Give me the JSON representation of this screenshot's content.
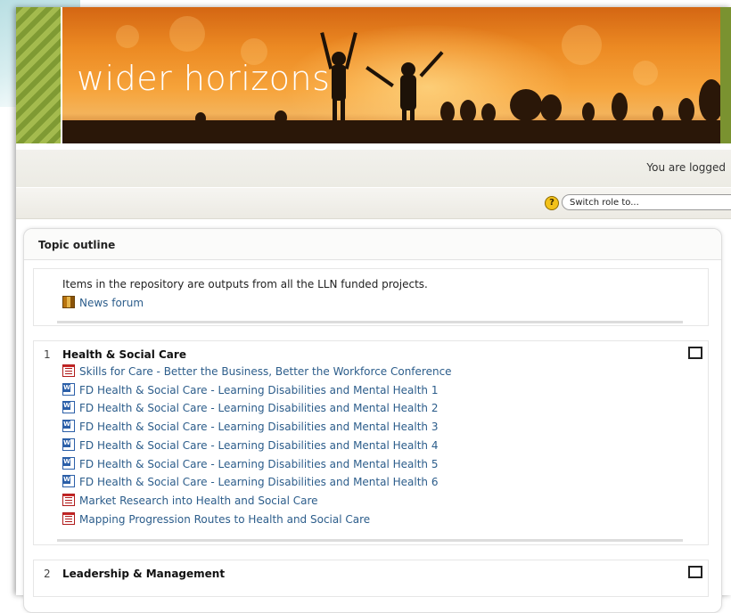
{
  "header": {
    "site_title": "wider horizons"
  },
  "loginbar": {
    "text": "You are logged"
  },
  "navbar": {
    "switch_role": "Switch role to..."
  },
  "course": {
    "outline_label": "Topic outline",
    "intro": {
      "summary": "Items in the repository are outputs from all the LLN funded projects.",
      "resources": [
        {
          "label": "News forum",
          "icon": "forum-icon"
        }
      ]
    },
    "sections": [
      {
        "number": "1",
        "title": "Health & Social Care",
        "resources": [
          {
            "label": "Skills for Care - Better the Business, Better the Workforce Conference",
            "icon": "pdf-icon"
          },
          {
            "label": "FD Health & Social Care - Learning Disabilities and Mental Health 1",
            "icon": "word-icon"
          },
          {
            "label": "FD Health & Social Care - Learning Disabilities and Mental Health 2",
            "icon": "word-icon"
          },
          {
            "label": "FD Health & Social Care - Learning Disabilities and Mental Health 3",
            "icon": "word-icon"
          },
          {
            "label": "FD Health & Social Care - Learning Disabilities and Mental Health 4",
            "icon": "word-icon"
          },
          {
            "label": "FD Health & Social Care - Learning Disabilities and Mental Health 5",
            "icon": "word-icon"
          },
          {
            "label": "FD Health & Social Care - Learning Disabilities and Mental Health 6",
            "icon": "word-icon"
          },
          {
            "label": "Market Research into Health and Social Care",
            "icon": "pdf-icon"
          },
          {
            "label": "Mapping Progression Routes to Health and Social Care",
            "icon": "pdf-icon"
          }
        ]
      },
      {
        "number": "2",
        "title": "Leadership & Management"
      }
    ]
  }
}
